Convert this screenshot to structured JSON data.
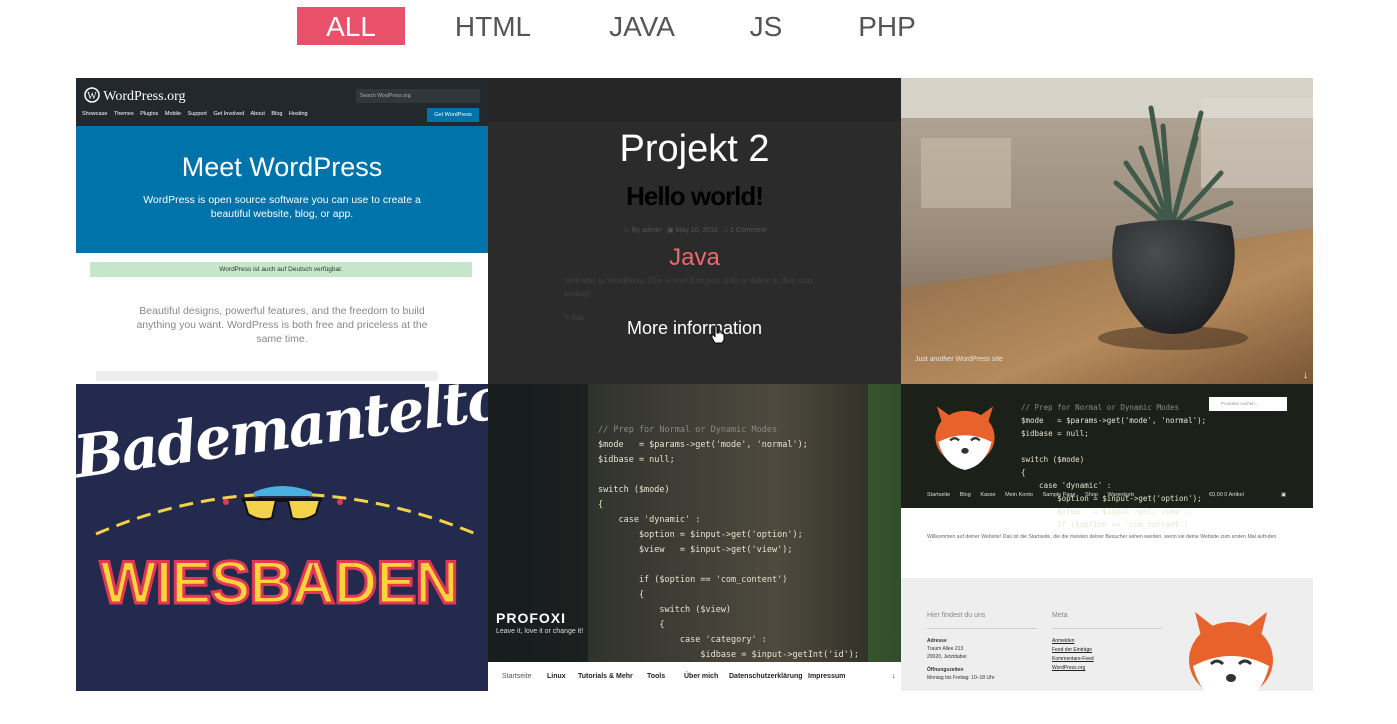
{
  "filters": {
    "all": "ALL",
    "html": "HTML",
    "java": "JAVA",
    "js": "JS",
    "php": "PHP"
  },
  "colors": {
    "accent": "#e9506a",
    "wp_blue": "#0073aa"
  },
  "tiles": {
    "wordpress": {
      "logo": "WordPress.org",
      "search_placeholder": "Search WordPress.org",
      "nav": [
        "Showcase",
        "Themes",
        "Plugins",
        "Mobile",
        "Support",
        "Get Involved",
        "About",
        "Blog",
        "Hosting"
      ],
      "get_button": "Get WordPress",
      "hero_title": "Meet WordPress",
      "hero_text": "WordPress is open source software you can use to create a beautiful website, blog, or app.",
      "notice": "WordPress ist auch auf Deutsch verfügbar.",
      "body_text": "Beautiful designs, powerful features, and the freedom to build anything you want. WordPress is both free and priceless at the same time."
    },
    "projekt2": {
      "title": "Projekt 2",
      "hello": "Hello world!",
      "meta_author": "By admin",
      "meta_date": "May 10, 2018",
      "meta_comments": "1 Comment",
      "category": "Java",
      "welcome": "Welcome to WordPress. This is your first post. Edit or delete it, then start writing!",
      "edit": "Edit",
      "more": "More information"
    },
    "plant": {
      "tagline": "Just another WordPress site"
    },
    "bademantel": {
      "title": "Bademanteltow",
      "city": "WIESBADEN"
    },
    "profoxi": {
      "name": "PROFOXI",
      "tagline": "Leave it, love it or change it!",
      "nav": [
        "Startseite",
        "Linux",
        "Tutorials & Mehr",
        "Tools",
        "Über mich",
        "Datenschutzerklärung",
        "Impressum"
      ]
    },
    "fox": {
      "search_placeholder": "Produkte suchen...",
      "nav": [
        "Startseite",
        "Blog",
        "Kasse",
        "Mein Konto",
        "Sample Page",
        "Shop",
        "Warenkorb"
      ],
      "cart": "€0,00  0 Artikel",
      "welcome": "Willkommen auf deiner Website! Das ist die Startseite, die die meisten deiner Besucher sehen werden, wenn sie deine Website zum ersten Mal aufrufen.",
      "footer_find": "Hier findest du uns",
      "address_label": "Adresse",
      "address_street": "Traum Allee 213",
      "address_city": "20020, Jetztdabei",
      "hours_label": "Öffnungszeiten",
      "hours": "Montag bis Freitag: 10–18 Uhr",
      "meta_heading": "Meta",
      "meta_links": [
        "Anmelden",
        "Feed der Einträge",
        "Kommentare-Feed",
        "WordPress.org"
      ]
    }
  }
}
